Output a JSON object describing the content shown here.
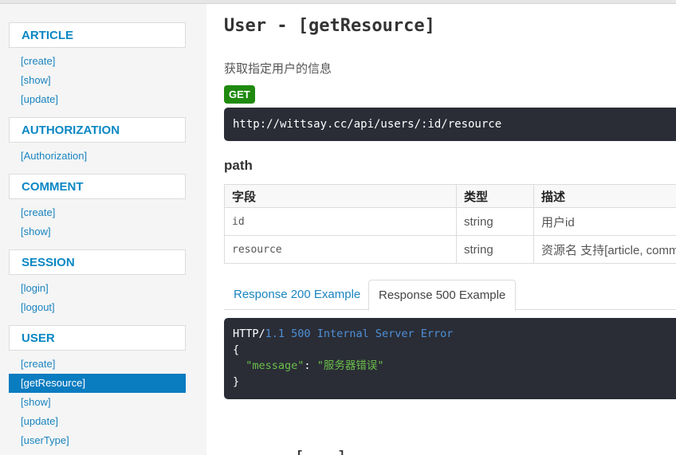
{
  "sidebar": {
    "groups": [
      {
        "title": "ARTICLE",
        "items": [
          "[create]",
          "[show]",
          "[update]"
        ]
      },
      {
        "title": "AUTHORIZATION",
        "items": [
          "[Authorization]"
        ]
      },
      {
        "title": "COMMENT",
        "items": [
          "[create]",
          "[show]"
        ]
      },
      {
        "title": "SESSION",
        "items": [
          "[login]",
          "[logout]"
        ]
      },
      {
        "title": "USER",
        "items": [
          "[create]",
          "[getResource]",
          "[show]",
          "[update]",
          "[userType]",
          "[..."
        ],
        "active_index": 1
      }
    ]
  },
  "main": {
    "title": "User - [getResource]",
    "description": "获取指定用户的信息",
    "method": "GET",
    "url": "http://wittsay.cc/api/users/:id/resource",
    "section_title": "path",
    "table": {
      "headers": [
        "字段",
        "类型",
        "描述"
      ],
      "rows": [
        [
          "id",
          "string",
          "用户id"
        ],
        [
          "resource",
          "string",
          "资源名 支持[article, comm"
        ]
      ]
    },
    "tabs": [
      "Response 200 Example",
      "Response 500 Example"
    ],
    "active_tab": 1,
    "code": {
      "http": "HTTP/",
      "version": "1.1",
      "status": "500",
      "status_text": "Internal Server Error",
      "open_brace": "{",
      "key": "\"message\"",
      "colon": ": ",
      "value": "\"服务器错误\"",
      "close_brace": "}"
    },
    "next_title": "[...]"
  },
  "colors": {
    "sidebar_link": "#1a84c0",
    "active_bg": "#0a7cc0",
    "badge_green": "#1f8a0f",
    "code_bg": "#2a2d36"
  }
}
